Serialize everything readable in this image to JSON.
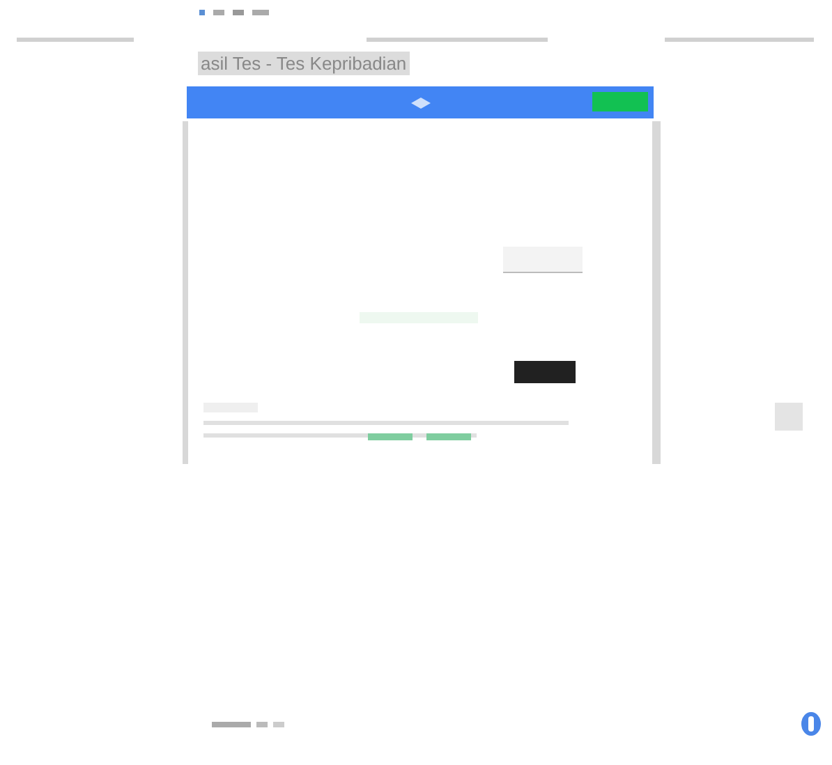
{
  "page_title": "asil Tes - Tes Kepribadian"
}
